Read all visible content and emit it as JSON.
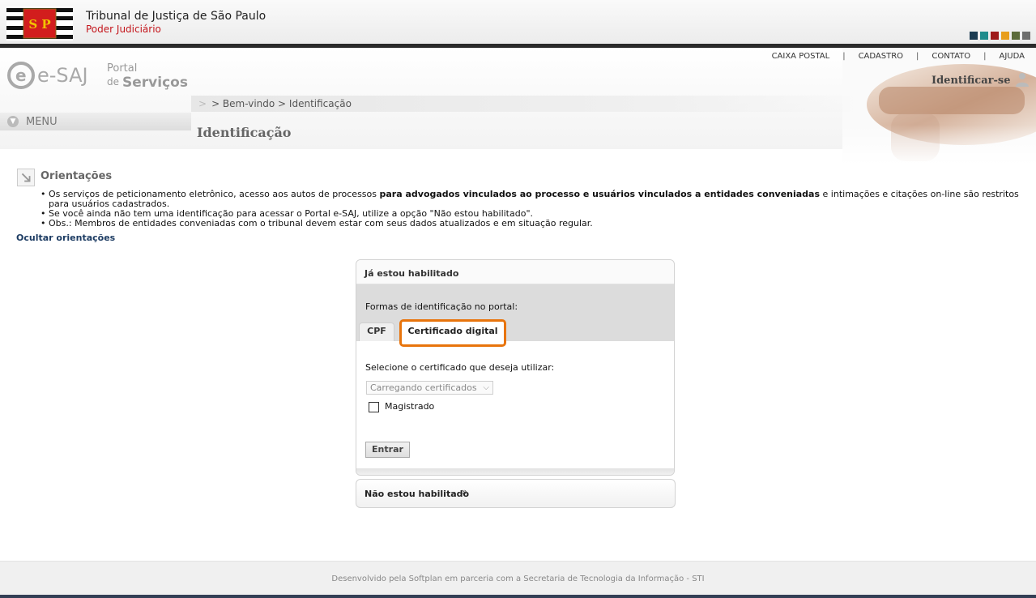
{
  "header": {
    "court_name": "Tribunal de Justiça de São Paulo",
    "court_sub": "Poder Judiciário",
    "logo_letters": "S P",
    "swatches": [
      "#1d3c52",
      "#1f8c8c",
      "#9e1a1a",
      "#e89e1c",
      "#5b6b3a",
      "#6e6e6e"
    ]
  },
  "portal": {
    "brand": "e-SAJ",
    "portal_word": "Portal",
    "de_word": "de",
    "servicos_word": "Serviços",
    "links": [
      "CAIXA POSTAL",
      "CADASTRO",
      "CONTATO",
      "AJUDA"
    ],
    "separator": "|",
    "identify_label": "Identificar-se",
    "menu_label": "MENU"
  },
  "breadcrumb": "> Bem-vindo > Identificação",
  "page_title": "Identificação",
  "orientacoes": {
    "title": "Orientações",
    "item1_a": "Os serviços de peticionamento eletrônico, acesso aos autos de processos ",
    "item1_b": "para advogados vinculados ao processo e usuários vinculados a entidades conveniadas",
    "item1_c": " e intimações e citações on-line são restritos para usuários cadastrados.",
    "item2": "Se você ainda não tem uma identificação para acessar o Portal e-SAJ, utilize a opção \"Não estou habilitado\".",
    "item3": "Obs.: Membros de entidades conveniadas com o tribunal devem estar com seus dados atualizados e em situação regular.",
    "hide_link": "Ocultar orientações"
  },
  "login_panel": {
    "title": "Já estou habilitado",
    "formas_label": "Formas de identificação no portal:",
    "tabs": [
      "CPF",
      "Certificado digital"
    ],
    "select_label": "Selecione o certificado que deseja utilizar:",
    "select_value": "Carregando certificados",
    "checkbox_label": "Magistrado",
    "submit_label": "Entrar"
  },
  "not_enabled": {
    "label": "Não estou habilitado",
    "arrow": "»"
  },
  "footer": "Desenvolvido pela Softplan em parceria com a Secretaria de Tecnologia da Informação - STI"
}
